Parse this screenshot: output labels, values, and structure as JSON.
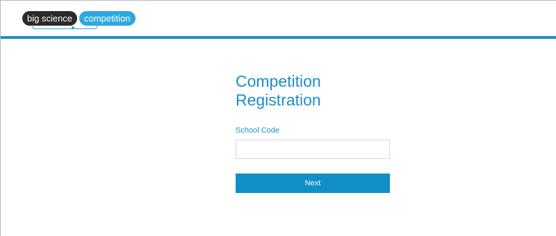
{
  "header": {
    "logo": {
      "part_1": "big science",
      "part_2": "competition"
    }
  },
  "registration": {
    "title_line_1": "Competition",
    "title_line_2": "Registration",
    "school_code": {
      "label": "School Code",
      "value": "",
      "placeholder": ""
    },
    "next_label": "Next"
  },
  "colors": {
    "accent": "#1b8fc7",
    "button": "#118fc8",
    "logo_dark": "#2b2b2b",
    "logo_blue": "#2da8df",
    "input_border": "#d9d9d9"
  },
  "icons": {
    "logo": "big-science-competition-logo"
  }
}
